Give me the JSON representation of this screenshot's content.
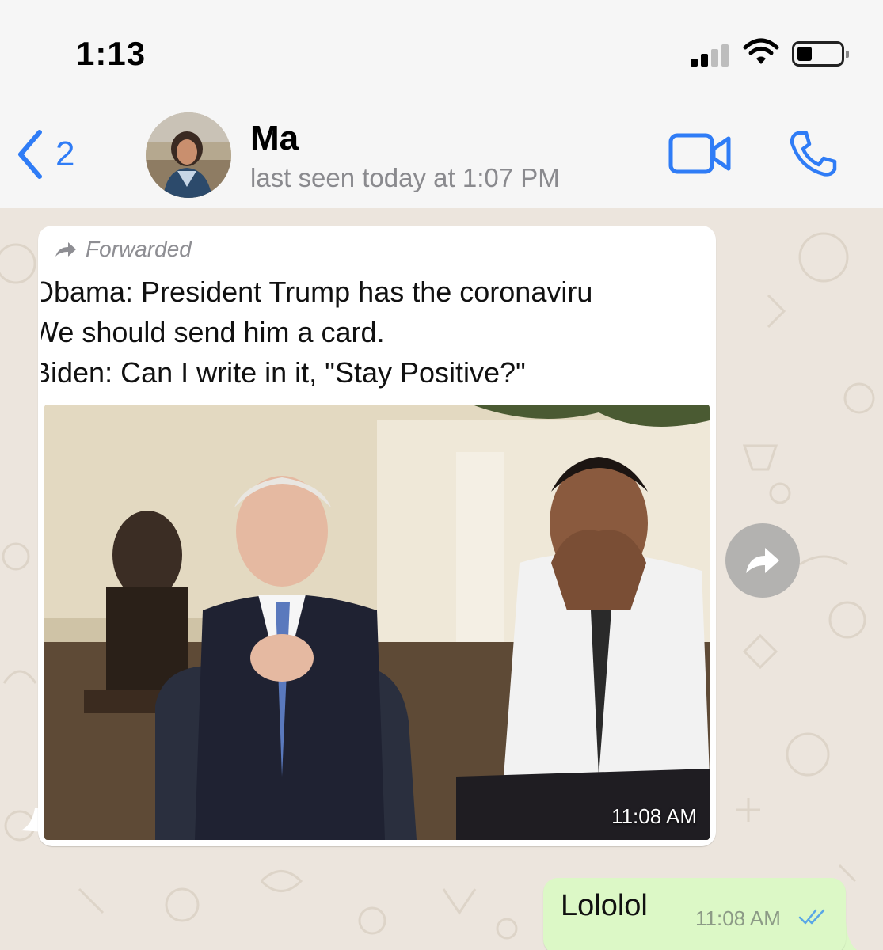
{
  "status_bar": {
    "time": "1:13"
  },
  "header": {
    "back_count": "2",
    "contact_name": "Ma",
    "last_seen": "last seen today at 1:07 PM"
  },
  "messages": {
    "incoming": {
      "forwarded_label": "Forwarded",
      "meme_lines": [
        "Obama: President Trump has the coronaviru",
        "We should send him a card.",
        "Biden: Can I write in it, \"Stay Positive?\""
      ],
      "time": "11:08 AM"
    },
    "outgoing": {
      "text": "Lololol",
      "time": "11:08 AM",
      "status": "read"
    }
  },
  "colors": {
    "accent": "#2f7cf6",
    "outgoing_bubble": "#dcf8c6",
    "incoming_bubble": "#ffffff",
    "chat_background": "#ece5dd",
    "read_ticks": "#5aa7e6"
  },
  "icons": {
    "back": "chevron-left-icon",
    "video": "video-camera-icon",
    "call": "phone-icon",
    "forwarded": "forward-arrow-icon",
    "share": "share-forward-icon",
    "read_receipt": "double-check-icon"
  }
}
